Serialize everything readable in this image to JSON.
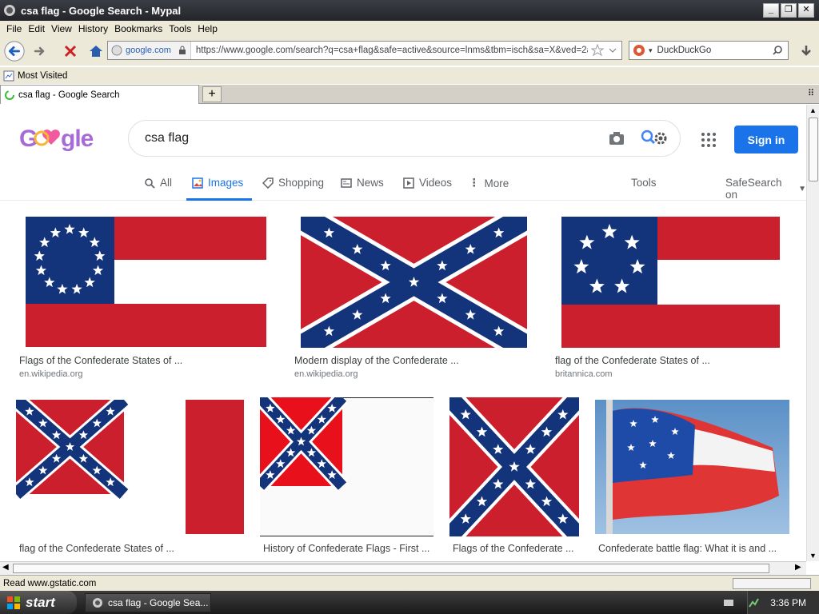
{
  "window": {
    "title": "csa flag - Google Search - Mypal"
  },
  "menu": [
    "File",
    "Edit",
    "View",
    "History",
    "Bookmarks",
    "Tools",
    "Help"
  ],
  "nav": {
    "site_label": "google.com",
    "url": "https://www.google.com/search?q=csa+flag&safe=active&source=lnms&tbm=isch&sa=X&ved=2ahUI",
    "search_engine": "DuckDuckGo"
  },
  "bookmarks": {
    "most_visited": "Most Visited"
  },
  "tab": {
    "title": "csa flag - Google Search",
    "new_tab": "+"
  },
  "google": {
    "query": "csa flag",
    "sign_in": "Sign in",
    "tabs": [
      "All",
      "Images",
      "Shopping",
      "News",
      "Videos",
      "More"
    ],
    "tools": "Tools",
    "safesearch": "SafeSearch on"
  },
  "results": [
    {
      "caption": "Flags of the Confederate States of ...",
      "domain": "en.wikipedia.org",
      "kind": "stars-bars-ring"
    },
    {
      "caption": "Modern display of the Confederate ...",
      "domain": "en.wikipedia.org",
      "kind": "battle-wide"
    },
    {
      "caption": "flag of the Confederate States of ...",
      "domain": "britannica.com",
      "kind": "stars-bars-seven"
    },
    {
      "caption": "flag of the Confederate States of ...",
      "domain": "",
      "kind": "third-national"
    },
    {
      "caption": "History of Confederate Flags - First ...",
      "domain": "",
      "kind": "second-national"
    },
    {
      "caption": "Flags of the Confederate ...",
      "domain": "",
      "kind": "battle-square"
    },
    {
      "caption": "Confederate battle flag: What it is and ...",
      "domain": "",
      "kind": "waving-photo"
    }
  ],
  "status": {
    "text": "Read www.gstatic.com"
  },
  "taskbar": {
    "start": "start",
    "item": "csa flag - Google Sea...",
    "clock": "3:36 PM"
  }
}
